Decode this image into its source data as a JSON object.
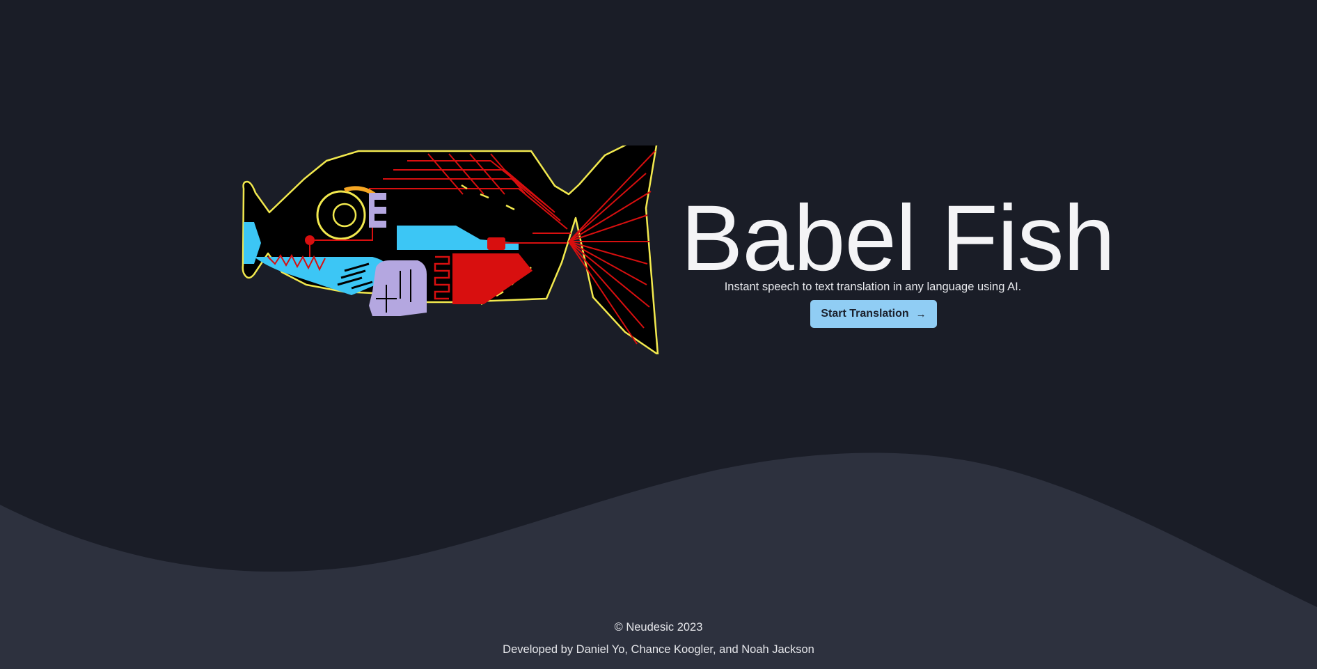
{
  "hero": {
    "title": "Babel Fish",
    "subtitle": "Instant speech to text translation in any language using AI.",
    "cta_label": "Start Translation",
    "cta_icon": "arrow-right-icon"
  },
  "footer": {
    "copyright": "© Neudesic 2023",
    "credits": "Developed by Daniel Yo, Chance Koogler, and Noah Jackson"
  },
  "colors": {
    "background": "#1a1d27",
    "wave": "#2d313e",
    "accent_button": "#90cdf4",
    "fish_outline": "#f2e94e",
    "fish_red": "#d80f0f",
    "fish_blue": "#3cc6f5",
    "fish_purple": "#b4a7e0"
  }
}
